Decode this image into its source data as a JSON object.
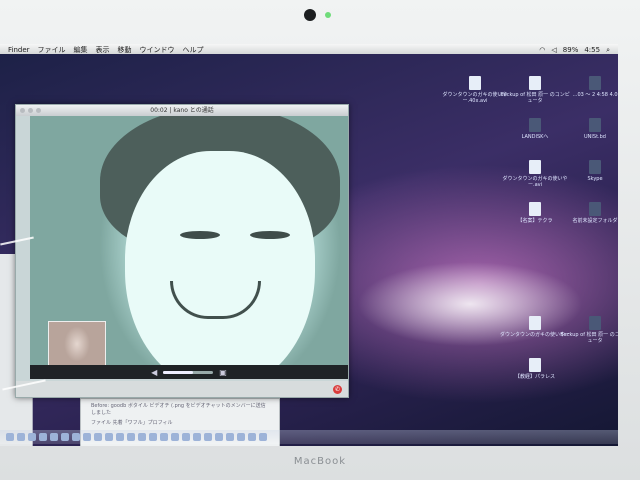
{
  "menubar": {
    "items": [
      "Finder",
      "ファイル",
      "編集",
      "表示",
      "移動",
      "ウインドウ",
      "ヘルプ"
    ],
    "status": [
      "89%",
      "4:55"
    ]
  },
  "video_call": {
    "title": "00:02 | kano との通話",
    "volume_fraction": 0.6
  },
  "chat_window": {
    "line1": "Before: goodb ボタイル ビデオチ (.png をビデオチャットのメンバーに送信しました",
    "line2": "ファイル 先着「ワフル」プロフィル"
  },
  "desktop_icons": [
    "ダウンタウンのガキの使いやー.40x.avi",
    "Backup of 松田 原一 のコンピュータ",
    "…03 ～ 2 4:58 4.0",
    "LANDISKへ",
    "UNISt.bd",
    "ダウンタウンのガキの使いやー.avi",
    "Skype",
    "【名案】テクラ",
    "名前未設定フォルダ",
    "ダウンタウンのガキの使いやー",
    "Backup of 松田 原一 のコンピュータ",
    "【教経】パラレス"
  ],
  "brand": "MacBook"
}
